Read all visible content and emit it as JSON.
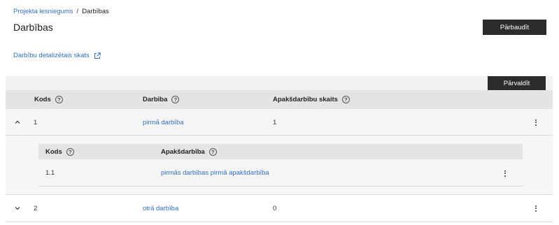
{
  "breadcrumb": {
    "parent": "Projekta iesniegums",
    "separator": "/",
    "current": "Darbības"
  },
  "page": {
    "title": "Darbības",
    "check_button": "Pārbaudīt",
    "detail_link": "Darbību detalizētais skats",
    "manage_button": "Pārvaldīt"
  },
  "table": {
    "columns": [
      "Kods",
      "Darbība",
      "Apakšdarbību skaits"
    ],
    "rows": [
      {
        "code": "1",
        "name": "pirmā darbība",
        "sub_count": "1",
        "expanded": true
      },
      {
        "code": "2",
        "name": "otrā darbība",
        "sub_count": "0",
        "expanded": false
      }
    ]
  },
  "subtable": {
    "columns": [
      "Kods",
      "Apakšdarbība"
    ],
    "rows": [
      {
        "code": "1.1",
        "name": "pirmās darbības pirmā apakšdarbība"
      }
    ]
  },
  "colors": {
    "link": "#2f6fc6",
    "button_dark": "#2c2c2c",
    "header_bg": "#e4e4e4"
  }
}
